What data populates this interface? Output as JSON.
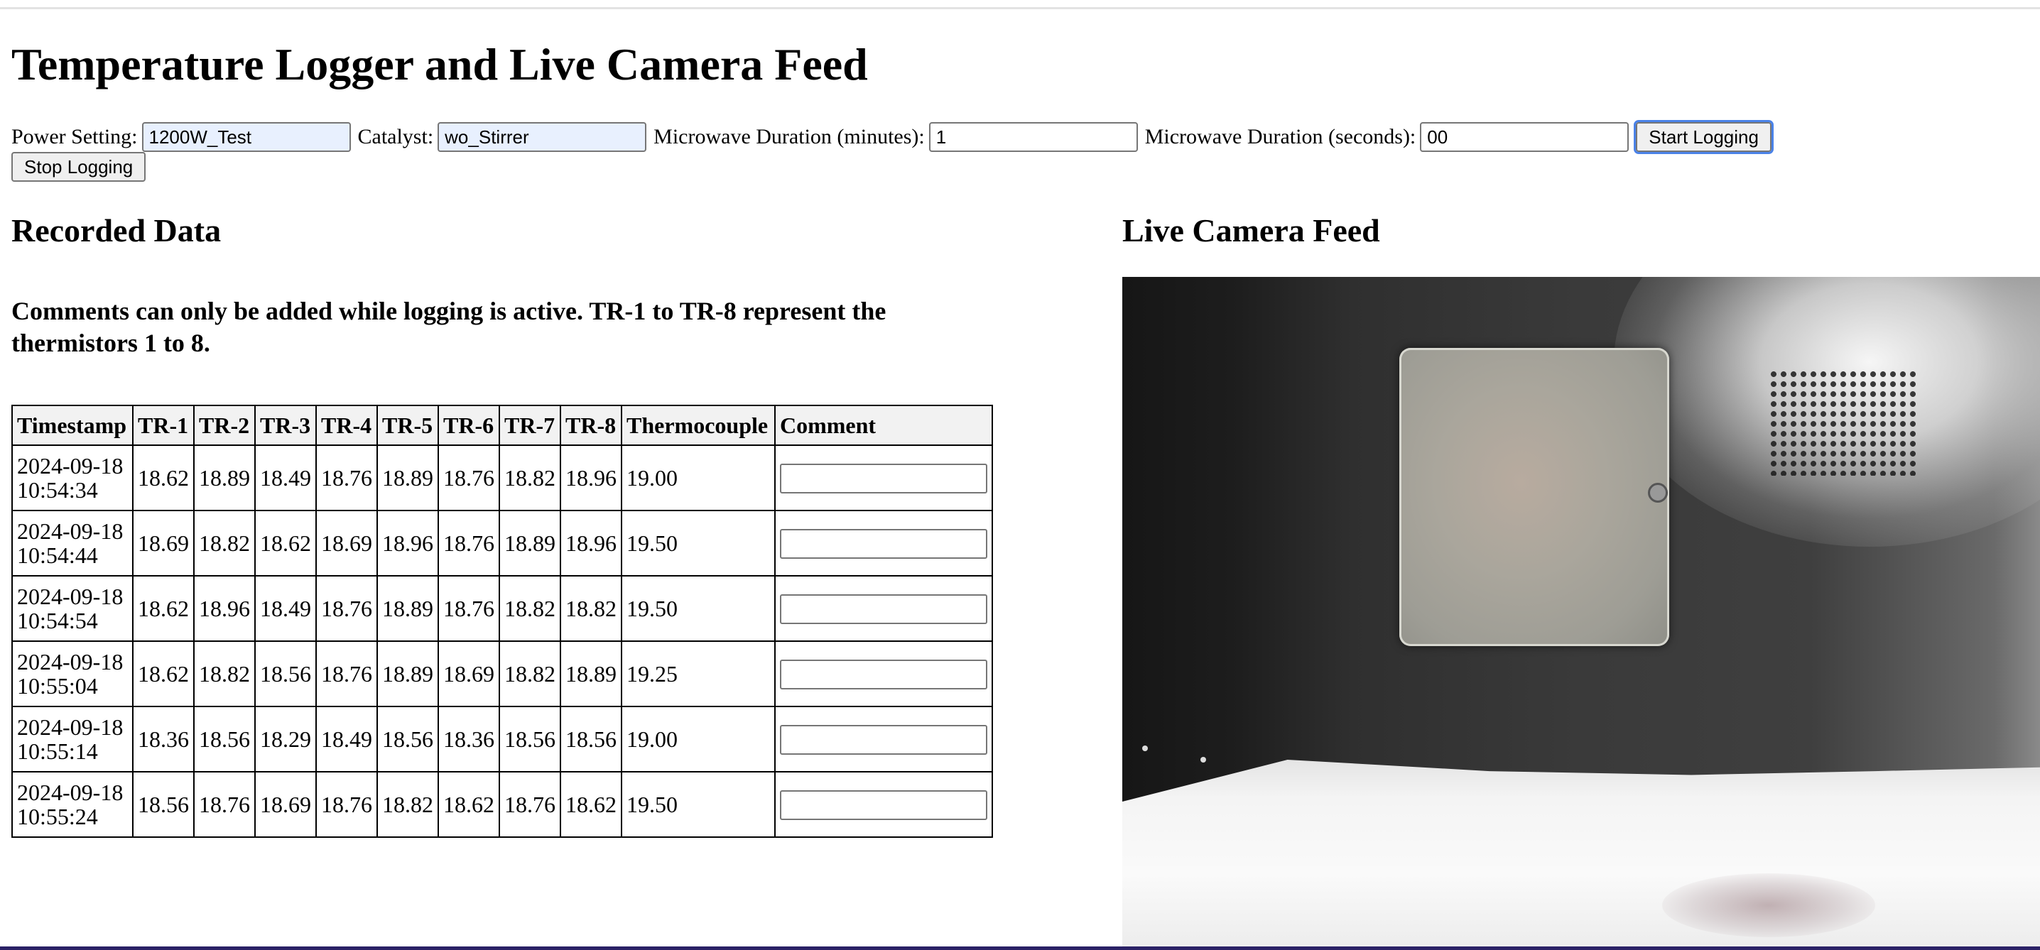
{
  "page_title": "Temperature Logger and Live Camera Feed",
  "controls": {
    "power_label": "Power Setting:",
    "power_value": "1200W_Test",
    "catalyst_label": "Catalyst:",
    "catalyst_value": "wo_Stirrer",
    "minutes_label": "Microwave Duration (minutes):",
    "minutes_value": "1",
    "seconds_label": "Microwave Duration (seconds):",
    "seconds_value": "00",
    "start_label": "Start Logging",
    "stop_label": "Stop Logging"
  },
  "recorded": {
    "heading": "Recorded Data",
    "note": "Comments can only be added while logging is active. TR-1 to TR-8 represent the thermistors 1 to 8.",
    "columns": [
      "Timestamp",
      "TR-1",
      "TR-2",
      "TR-3",
      "TR-4",
      "TR-5",
      "TR-6",
      "TR-7",
      "TR-8",
      "Thermocouple",
      "Comment"
    ],
    "rows": [
      {
        "date": "2024-09-18",
        "time": "10:54:34",
        "values": [
          "18.62",
          "18.89",
          "18.49",
          "18.76",
          "18.89",
          "18.76",
          "18.82",
          "18.96"
        ],
        "thermocouple": "19.00",
        "comment": ""
      },
      {
        "date": "2024-09-18",
        "time": "10:54:44",
        "values": [
          "18.69",
          "18.82",
          "18.62",
          "18.69",
          "18.96",
          "18.76",
          "18.89",
          "18.96"
        ],
        "thermocouple": "19.50",
        "comment": ""
      },
      {
        "date": "2024-09-18",
        "time": "10:54:54",
        "values": [
          "18.62",
          "18.96",
          "18.49",
          "18.76",
          "18.89",
          "18.76",
          "18.82",
          "18.82"
        ],
        "thermocouple": "19.50",
        "comment": ""
      },
      {
        "date": "2024-09-18",
        "time": "10:55:04",
        "values": [
          "18.62",
          "18.82",
          "18.56",
          "18.76",
          "18.89",
          "18.69",
          "18.82",
          "18.89"
        ],
        "thermocouple": "19.25",
        "comment": ""
      },
      {
        "date": "2024-09-18",
        "time": "10:55:14",
        "values": [
          "18.36",
          "18.56",
          "18.29",
          "18.49",
          "18.56",
          "18.36",
          "18.56",
          "18.56"
        ],
        "thermocouple": "19.00",
        "comment": ""
      },
      {
        "date": "2024-09-18",
        "time": "10:55:24",
        "values": [
          "18.56",
          "18.76",
          "18.69",
          "18.76",
          "18.82",
          "18.62",
          "18.76",
          "18.62"
        ],
        "thermocouple": "19.50",
        "comment": ""
      }
    ]
  },
  "camera": {
    "heading": "Live Camera Feed"
  }
}
